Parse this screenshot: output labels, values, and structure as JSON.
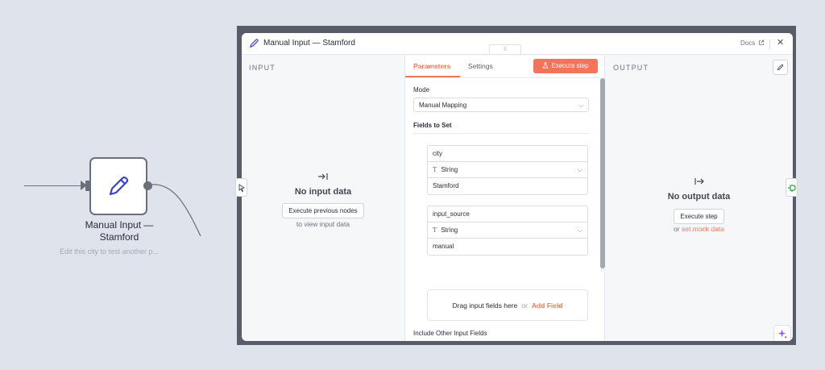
{
  "canvas": {
    "node": {
      "icon": "pencil-icon",
      "title": "Manual Input —\nStamford",
      "subtitle": "Edit this city to test another p..."
    }
  },
  "modal": {
    "header": {
      "icon": "pencil-icon",
      "title": "Manual Input — Stamford",
      "grip": "⠿",
      "docs_label": "Docs",
      "docs_icon": "external-link-icon",
      "close_icon": "close-icon"
    },
    "input_pane": {
      "label": "INPUT",
      "icon": "arrow-into-bar-icon",
      "empty_title": "No input data",
      "execute_button": "Execute previous nodes",
      "hint": "to view input data"
    },
    "parameters": {
      "tabs": [
        {
          "label": "Parameters",
          "active": true
        },
        {
          "label": "Settings",
          "active": false
        }
      ],
      "execute_button": "Execute step",
      "execute_icon": "flask-icon",
      "mode_label": "Mode",
      "mode_value": "Manual Mapping",
      "fields_label": "Fields to Set",
      "fields": [
        {
          "name": "city",
          "type": "String",
          "value": "Stamford"
        },
        {
          "name": "input_source",
          "type": "String",
          "value": "manual"
        }
      ],
      "dropzone_text": "Drag input fields here",
      "dropzone_or": "or",
      "dropzone_link": "Add Field",
      "include_label": "Include Other Input Fields",
      "include_on": false
    },
    "output_pane": {
      "label": "OUTPUT",
      "icon": "arrow-out-bar-icon",
      "empty_title": "No output data",
      "execute_button": "Execute step",
      "or_text": "or",
      "mock_link": "set mock data"
    },
    "colors": {
      "accent": "#f27559",
      "link": "#f07a5c",
      "green_handle": "#2f9e44",
      "ai_purple": "#8b5cf6"
    }
  }
}
